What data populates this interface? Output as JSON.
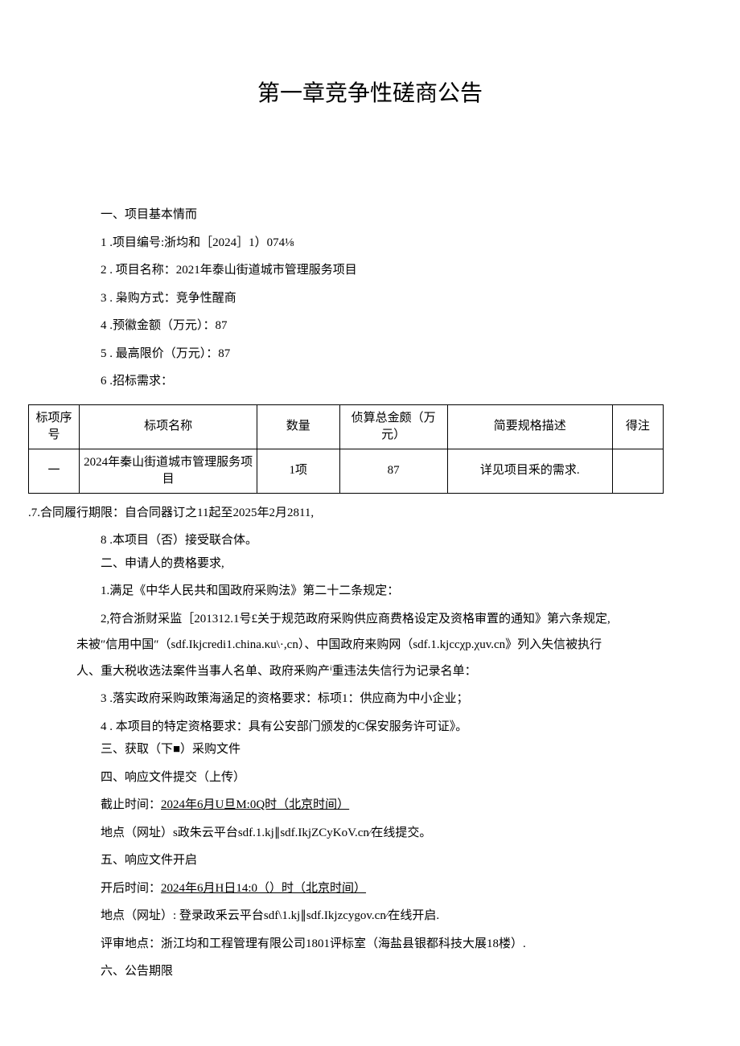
{
  "title": "第一章竞争性磋商公告",
  "section1": {
    "heading": "一、项目基本情而",
    "items": [
      "1 .项目编号:浙均和［2024］1）074⅛",
      "2 . 项目名称：2021年泰山街道城市管理服务项目",
      "3 . 枭购方式：竞争性醒商",
      "4 .预徽金额（万元）：87",
      "5 . 最高限价（万元）：87",
      "6 .招标需求："
    ]
  },
  "table": {
    "headers": {
      "seq": "标项序号",
      "name": "标项名称",
      "qty": "数量",
      "budget": "侦算总金颇（万元）",
      "spec": "简要规格描述",
      "note": "得注"
    },
    "row": {
      "seq": "一",
      "name": "2024年秦山街道城市管理服务项目",
      "qty": "1项",
      "budget": "87",
      "spec": "详见项目釆的需求.",
      "note": ""
    }
  },
  "item7": ".7.合同履行期限：自合同器订之11起至2025年2月2811,",
  "item8": "8 .本项目（否）接受联合体。",
  "section2": {
    "heading": "二、申请人的费格要求,",
    "item1": "1.满足《中华人民共和国政府采购法》第二十二条规定：",
    "item2_line1": "2,符合浙财采监［201312.1号£关于规范政府采购供应商费格设定及资格审置的通知》第六条规定,",
    "item2_line2": "未被″信用中国″（sdf.Ikjcredi1.china.κu\\·,cn）、中国政府来购网（sdf.1.kjccχp.χuv.cn》列入失信被执行",
    "item2_line3": "人、重大税收选法案件当事人名单、政府釆购产ⁱ重违法失信行为记录名单：",
    "item3": "3 .落实政府采购政策海涵足的资格要求：标项1：供应商为中小企业；",
    "item4": "4 . 本项目的特定资格要求：具有公安部门颁发的C保安服务许可证》。"
  },
  "section3": {
    "heading": "三、获取（下■）采购文件"
  },
  "section4": {
    "heading": "四、响应文件提交（上传）",
    "deadline_label": "截止时间：",
    "deadline_value": "2024年6月U旦M:0Q时（北京时间）",
    "location": "地点（网址）s政朱云平台sdf.1.kj∥sdf.IkjZCyKoV.cn∕在线提交。"
  },
  "section5": {
    "heading": "五、响应文件开启",
    "open_label": "开后时间：",
    "open_value": "2024年6月H日14:0（）时（北京时间）",
    "location": "地点（网址）: 登录政釆云平台sdf\\1.kj∥sdf.Ikjzcygov.cn∕在线开启.",
    "review": "评审地点：浙江均和工程管理有限公司1801评标室（海盐县银都科技大展18楼）."
  },
  "section6": {
    "heading": "六、公告期限"
  }
}
